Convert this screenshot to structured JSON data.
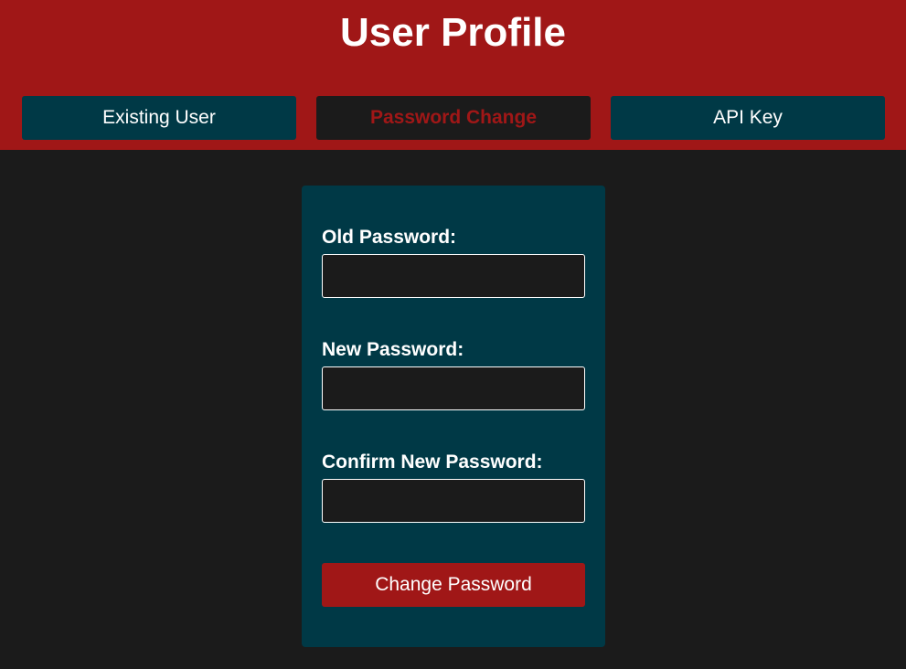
{
  "header": {
    "title": "User Profile"
  },
  "tabs": [
    {
      "label": "Existing User",
      "active": false
    },
    {
      "label": "Password Change",
      "active": true
    },
    {
      "label": "API Key",
      "active": false
    }
  ],
  "form": {
    "old_password": {
      "label": "Old Password:",
      "value": "",
      "placeholder": ""
    },
    "new_password": {
      "label": "New Password:",
      "value": "",
      "placeholder": ""
    },
    "confirm_password": {
      "label": "Confirm New Password:",
      "value": "",
      "placeholder": ""
    },
    "submit_label": "Change Password"
  },
  "colors": {
    "header_bg": "#a01717",
    "page_bg": "#1b1b1b",
    "panel_bg": "#003946",
    "accent": "#a01717",
    "text": "#ffffff"
  }
}
